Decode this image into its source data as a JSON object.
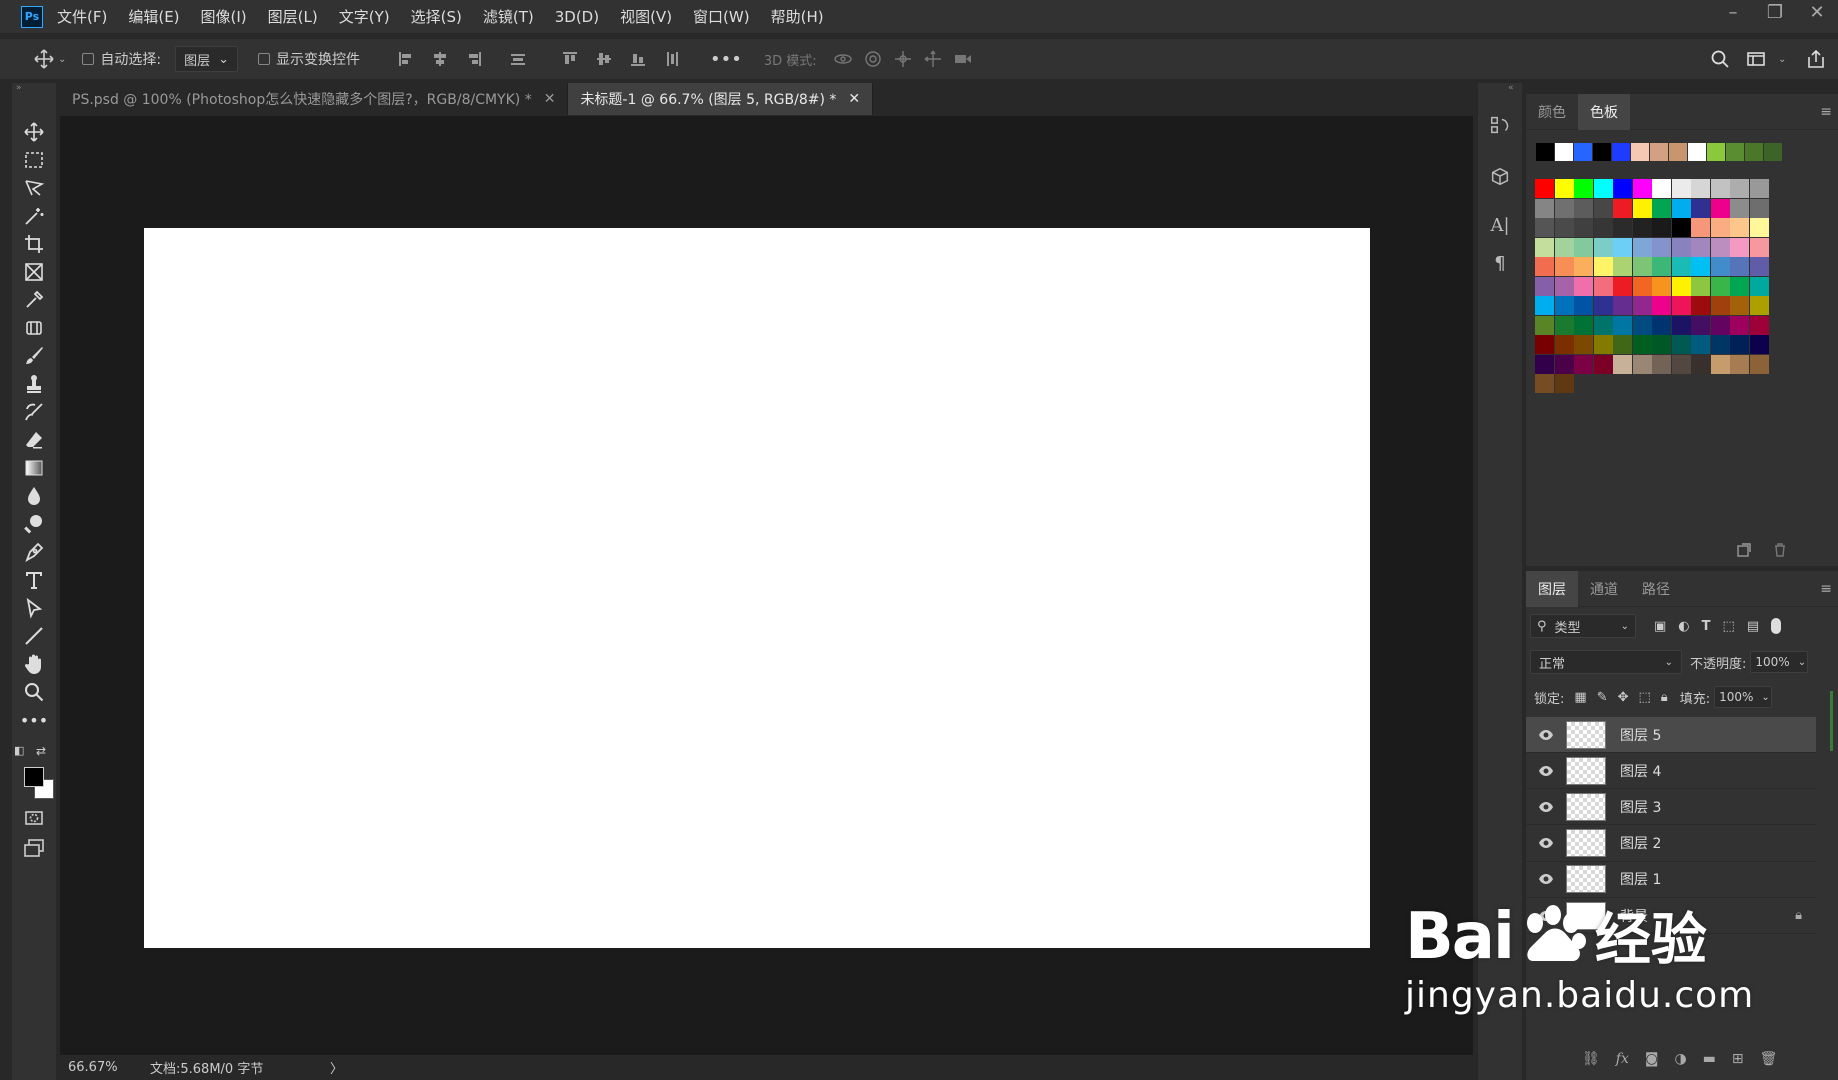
{
  "app": {
    "logo": "Ps"
  },
  "menu": [
    "文件(F)",
    "编辑(E)",
    "图像(I)",
    "图层(L)",
    "文字(Y)",
    "选择(S)",
    "滤镜(T)",
    "3D(D)",
    "视图(V)",
    "窗口(W)",
    "帮助(H)"
  ],
  "options": {
    "auto_select_label": "自动选择:",
    "auto_select_value": "图层",
    "show_transform_label": "显示变换控件",
    "mode_3d_label": "3D 模式:"
  },
  "tabs": [
    {
      "label": "PS.psd @ 100% (Photoshop怎么快速隐藏多个图层?，RGB/8/CMYK) *",
      "active": false
    },
    {
      "label": "未标题-1 @ 66.7% (图层 5, RGB/8#) *",
      "active": true
    }
  ],
  "status": {
    "zoom": "66.67%",
    "doc_info": "文档:5.68M/0 字节",
    "arrow": "〉"
  },
  "swatches_panel": {
    "tabs": [
      "颜色",
      "色板"
    ],
    "active_tab": "色板"
  },
  "layers_panel": {
    "tabs": [
      "图层",
      "通道",
      "路径"
    ],
    "filter_value": "类型",
    "blend_mode": "正常",
    "opacity_label": "不透明度:",
    "opacity_value": "100%",
    "lock_label": "锁定:",
    "fill_label": "填充:",
    "fill_value": "100%",
    "layers": [
      {
        "name": "图层 5",
        "selected": true
      },
      {
        "name": "图层 4",
        "selected": false
      },
      {
        "name": "图层 3",
        "selected": false
      },
      {
        "name": "图层 2",
        "selected": false
      },
      {
        "name": "图层 1",
        "selected": false
      },
      {
        "name": "背景",
        "selected": false,
        "locked": true
      }
    ]
  },
  "watermark": {
    "brand": "Bai",
    "brand2": "经验",
    "url": "jingyan.baidu.com"
  },
  "recent_colors": [
    "#000000",
    "#ffffff",
    "#2864ff",
    "#000000",
    "#1e3cff",
    "#f5c8b4",
    "#d2a082",
    "#c8966e",
    "#ffffff",
    "#8cc83c",
    "#5a8c32",
    "#4b7828",
    "#3c6428"
  ],
  "swatch_rows": [
    [
      "#ff0000",
      "#ffff00",
      "#00ff00",
      "#00ffff",
      "#0000ff",
      "#ff00ff",
      "#ffffff",
      "#ebebeb",
      "#d6d6d6",
      "#c2c2c2",
      "#adadad",
      "#999999"
    ],
    [
      "#858585",
      "#707070",
      "#5c5c5c",
      "#474747",
      "#ed1c24",
      "#fff200",
      "#00a651",
      "#00aeef",
      "#2e3192",
      "#ec008c",
      "#8c8c8c",
      "#6e6e6e"
    ],
    [
      "#555555",
      "#4a4a4a",
      "#404040",
      "#363636",
      "#2b2b2b",
      "#222222",
      "#1a1a1a",
      "#000000",
      "#f7977a",
      "#f9ad81",
      "#fdc68a",
      "#fff79a"
    ],
    [
      "#c4df9b",
      "#a3d39c",
      "#82ca9d",
      "#7bcdc8",
      "#6ecff6",
      "#7ea7d8",
      "#8493ca",
      "#8882be",
      "#a187be",
      "#bc8dbf",
      "#f49ac2",
      "#f6989d"
    ],
    [
      "#f26c4f",
      "#f68e56",
      "#fbaf5c",
      "#fff467",
      "#acd372",
      "#7cc576",
      "#3bb878",
      "#1abbb4",
      "#00bff3",
      "#438ccb",
      "#5574b9",
      "#605ca8"
    ],
    [
      "#855fa8",
      "#a763a8",
      "#f06eaa",
      "#f26d7d",
      "#ed1c24",
      "#f26522",
      "#f7941d",
      "#fff200",
      "#8dc63f",
      "#39b54a",
      "#00a651",
      "#00a99d"
    ],
    [
      "#00aeef",
      "#0072bc",
      "#0054a6",
      "#2e3192",
      "#662d91",
      "#92278f",
      "#ec008c",
      "#ed145b",
      "#9e0b0f",
      "#a0410d",
      "#a3620a",
      "#aba000"
    ],
    [
      "#598527",
      "#1a7b30",
      "#007236",
      "#00746b",
      "#0076a3",
      "#004b80",
      "#003471",
      "#1b1464",
      "#440e62",
      "#630460",
      "#9e005d",
      "#9e0039"
    ],
    [
      "#790000",
      "#7b2e00",
      "#7d4900",
      "#827b00",
      "#406618",
      "#005e20",
      "#005826",
      "#005952",
      "#005b7f",
      "#003663",
      "#002157",
      "#0d004c"
    ],
    [
      "#32004b",
      "#4b0049",
      "#7b0046",
      "#7a0026",
      "#c7b299",
      "#998675",
      "#736357",
      "#534741",
      "#37302d",
      "#c69c6d",
      "#a67c52",
      "#8c6239"
    ],
    [
      "#754c24",
      "#603913"
    ]
  ]
}
